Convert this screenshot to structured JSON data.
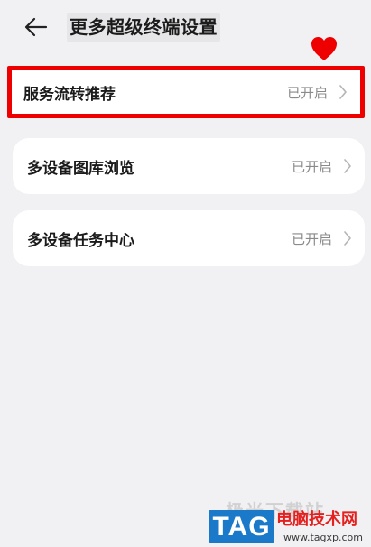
{
  "header": {
    "back_icon": "arrow-left-icon",
    "title": "更多超级终端设置"
  },
  "settings": [
    {
      "label": "服务流转推荐",
      "status": "已开启",
      "highlighted": true
    },
    {
      "label": "多设备图库浏览",
      "status": "已开启",
      "highlighted": false
    },
    {
      "label": "多设备任务中心",
      "status": "已开启",
      "highlighted": false
    }
  ],
  "annotation": {
    "icon": "heart-icon",
    "color": "#ee0000"
  },
  "watermark": {
    "ghost_text": "极光下载站",
    "logo_text": "TAG",
    "site_name": "电脑技术网",
    "site_url": "www.tagxp.com"
  },
  "colors": {
    "background": "#f1f1f3",
    "card": "#ffffff",
    "highlight_border": "#ee0000",
    "status_text": "#8a8a8a",
    "logo_blue": "#1a79c9"
  }
}
